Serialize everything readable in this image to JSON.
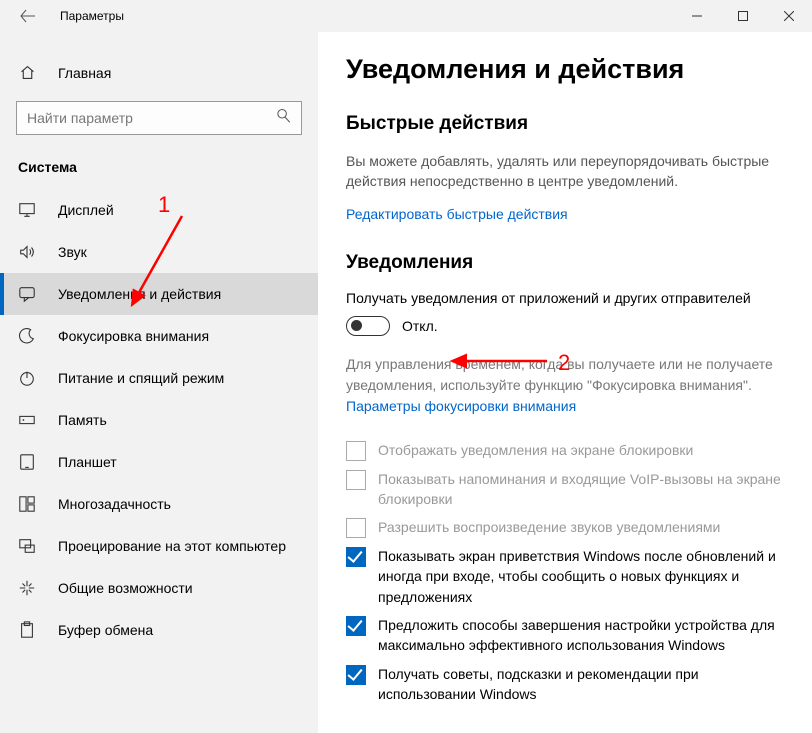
{
  "window": {
    "title": "Параметры"
  },
  "sidebar": {
    "home": "Главная",
    "search_placeholder": "Найти параметр",
    "group": "Система",
    "items": [
      {
        "label": "Дисплей"
      },
      {
        "label": "Звук"
      },
      {
        "label": "Уведомления и действия"
      },
      {
        "label": "Фокусировка внимания"
      },
      {
        "label": "Питание и спящий режим"
      },
      {
        "label": "Память"
      },
      {
        "label": "Планшет"
      },
      {
        "label": "Многозадачность"
      },
      {
        "label": "Проецирование на этот компьютер"
      },
      {
        "label": "Общие возможности"
      },
      {
        "label": "Буфер обмена"
      }
    ]
  },
  "content": {
    "page_title": "Уведомления и действия",
    "quick_actions": {
      "heading": "Быстрые действия",
      "desc": "Вы можете добавлять, удалять или переупорядочивать быстрые действия непосредственно в центре уведомлений.",
      "link": "Редактировать быстрые действия"
    },
    "notifications": {
      "heading": "Уведомления",
      "get_label": "Получать уведомления от приложений и других отправителей",
      "toggle_state": "Откл.",
      "focus_desc": "Для управления временем, когда вы получаете или не получаете уведомления, используйте функцию \"Фокусировка внимания\".",
      "focus_link": "Параметры фокусировки внимания",
      "checks": [
        {
          "label": "Отображать уведомления на экране блокировки",
          "checked": false,
          "disabled": true
        },
        {
          "label": "Показывать напоминания и входящие VoIP-вызовы на экране блокировки",
          "checked": false,
          "disabled": true
        },
        {
          "label": "Разрешить  воспроизведение звуков уведомлениями",
          "checked": false,
          "disabled": true
        },
        {
          "label": "Показывать экран приветствия Windows после обновлений и иногда при входе, чтобы сообщить о новых функциях и предложениях",
          "checked": true,
          "disabled": false
        },
        {
          "label": "Предложить способы завершения настройки устройства для максимально эффективного использования Windows",
          "checked": true,
          "disabled": false
        },
        {
          "label": "Получать советы, подсказки и рекомендации при использовании Windows",
          "checked": true,
          "disabled": false
        }
      ]
    }
  },
  "annotations": {
    "num1": "1",
    "num2": "2"
  }
}
